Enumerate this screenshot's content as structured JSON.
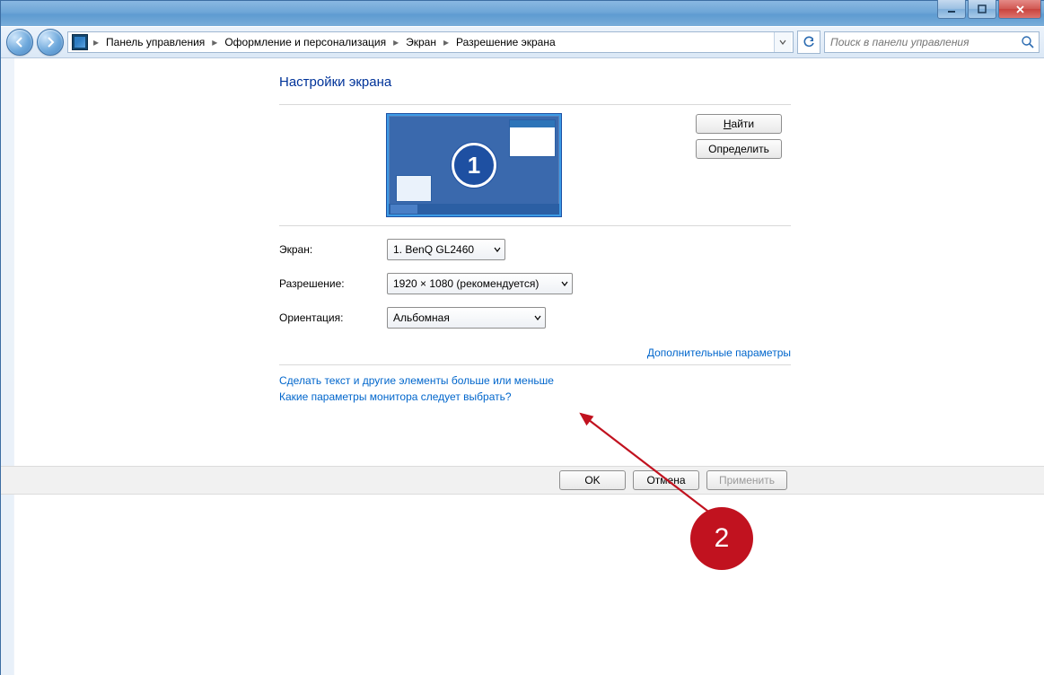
{
  "breadcrumb": {
    "items": [
      "Панель управления",
      "Оформление и персонализация",
      "Экран",
      "Разрешение экрана"
    ]
  },
  "search": {
    "placeholder": "Поиск в панели управления"
  },
  "page": {
    "heading": "Настройки экрана",
    "find_btn": "Найти",
    "detect_btn": "Определить",
    "monitor_number": "1",
    "labels": {
      "screen": "Экран:",
      "resolution": "Разрешение:",
      "orientation": "Ориентация:"
    },
    "screen_value": "1. BenQ GL2460",
    "resolution_value": "1920 × 1080 (рекомендуется)",
    "orientation_value": "Альбомная",
    "advanced_link": "Дополнительные параметры",
    "text_size_link": "Сделать текст и другие элементы больше или меньше",
    "which_link": "Какие параметры монитора следует выбрать?"
  },
  "footer": {
    "ok": "OK",
    "cancel": "Отмена",
    "apply": "Применить"
  },
  "annotation": {
    "number": "2"
  }
}
